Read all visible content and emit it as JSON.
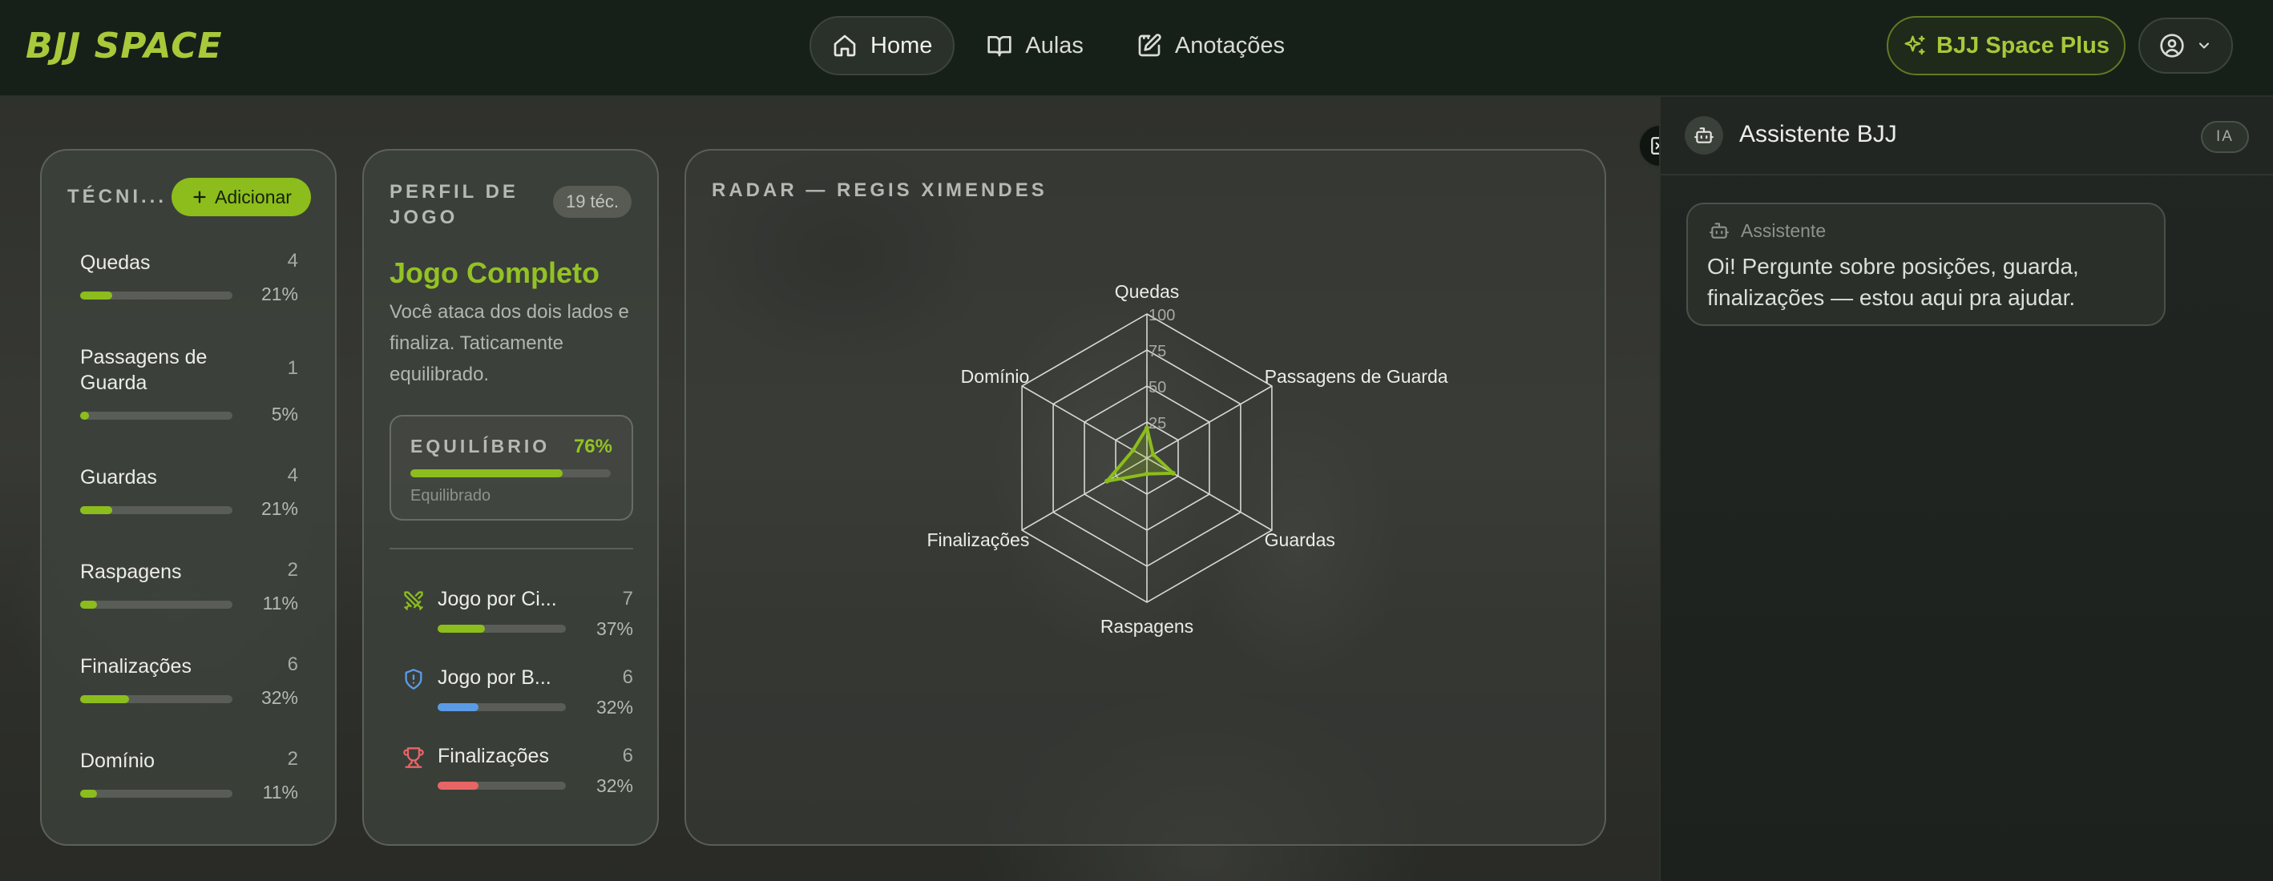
{
  "brand": {
    "logo": "BJJ SPACE"
  },
  "nav": {
    "items": [
      {
        "label": "Home",
        "icon": "home-icon",
        "active": true
      },
      {
        "label": "Aulas",
        "icon": "book-icon",
        "active": false
      },
      {
        "label": "Anotações",
        "icon": "edit-note-icon",
        "active": false
      }
    ]
  },
  "header": {
    "plus_label": "BJJ Space Plus",
    "user_icon": "user-circle-icon"
  },
  "tecnicas": {
    "title": "TÉCNI...",
    "add_label": "Adicionar",
    "items": [
      {
        "name": "Quedas",
        "count": "4",
        "pct": "21%",
        "fraction": 0.21
      },
      {
        "name": "Passagens de Guarda",
        "count": "1",
        "pct": "5%",
        "fraction": 0.05
      },
      {
        "name": "Guardas",
        "count": "4",
        "pct": "21%",
        "fraction": 0.21
      },
      {
        "name": "Raspagens",
        "count": "2",
        "pct": "11%",
        "fraction": 0.11
      },
      {
        "name": "Finalizações",
        "count": "6",
        "pct": "32%",
        "fraction": 0.32
      },
      {
        "name": "Domínio",
        "count": "2",
        "pct": "11%",
        "fraction": 0.11
      }
    ]
  },
  "perfil": {
    "title_line1": "PERFIL DE",
    "title_line2": "JOGO",
    "badge": "19 téc.",
    "jogo_title": "Jogo Completo",
    "jogo_desc": "Você ataca dos dois lados e finaliza. Taticamente equilibrado.",
    "equilibrio": {
      "label": "EQUILÍBRIO",
      "value": "76%",
      "fraction": 0.76,
      "sub": "Equilibrado"
    },
    "styles": [
      {
        "name": "Jogo por Ci...",
        "count": "7",
        "pct": "37%",
        "fraction": 0.37,
        "color": "#8cbd1c",
        "icon": "swords-icon"
      },
      {
        "name": "Jogo por B...",
        "count": "6",
        "pct": "32%",
        "fraction": 0.32,
        "color": "#5b9be6",
        "icon": "shield-icon"
      },
      {
        "name": "Finalizações",
        "count": "6",
        "pct": "32%",
        "fraction": 0.32,
        "color": "#e86565",
        "icon": "trophy-icon"
      }
    ]
  },
  "radar": {
    "title": "RADAR — REGIS XIMENDES",
    "chart_data": {
      "type": "radar",
      "axes": [
        "Quedas",
        "Passagens de Guarda",
        "Guardas",
        "Raspagens",
        "Finalizações",
        "Domínio"
      ],
      "values": [
        21,
        5,
        21,
        11,
        32,
        11
      ],
      "ticks": [
        "25",
        "50",
        "75",
        "100"
      ],
      "range": [
        0,
        100
      ],
      "color": "#8cbd1c"
    }
  },
  "assistant": {
    "title": "Assistente BJJ",
    "badge": "IA",
    "message_label": "Assistente",
    "message_text": "Oi! Pergunte sobre posições, guarda, finalizações — estou aqui pra ajudar."
  }
}
